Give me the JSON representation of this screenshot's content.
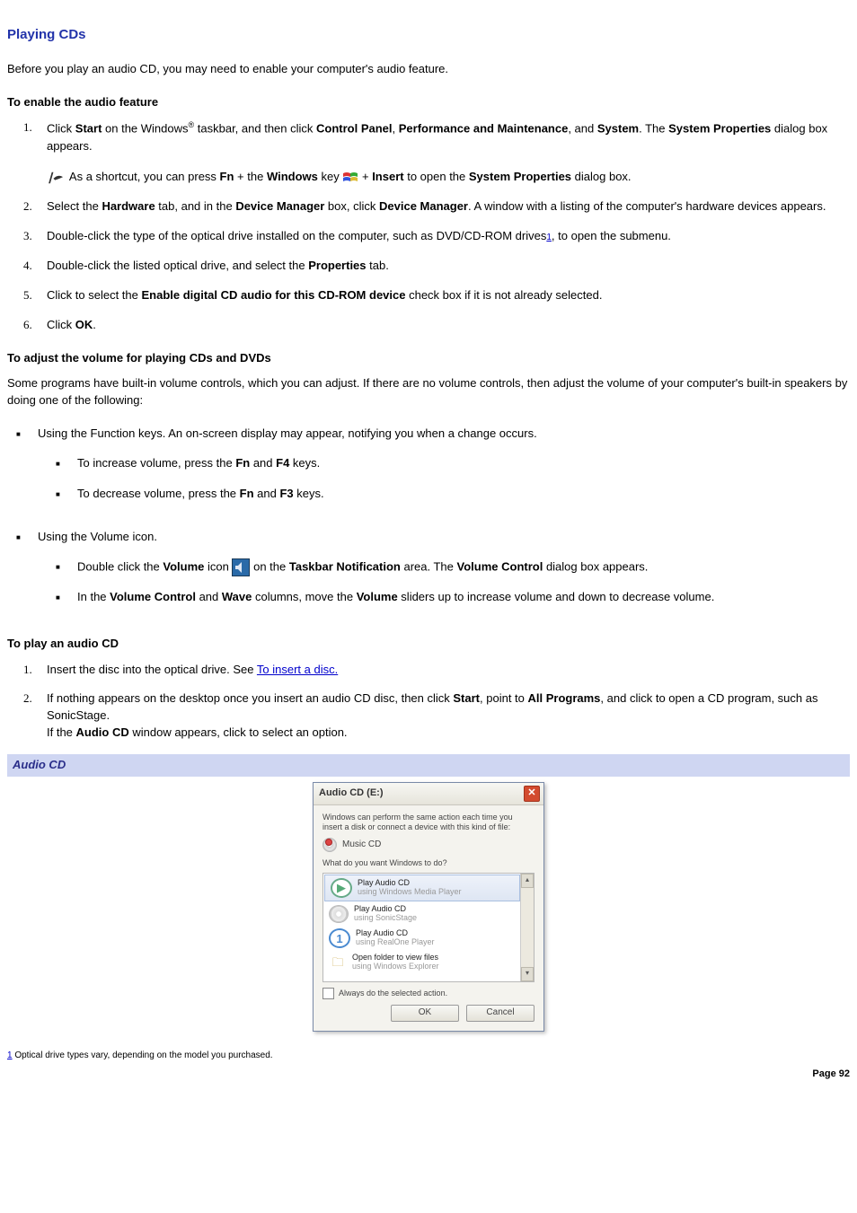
{
  "heading": "Playing CDs",
  "intro": "Before you play an audio CD, you may need to enable your computer's audio feature.",
  "section1_title": "To enable the audio feature",
  "s1_li1_a": "Click ",
  "s1_li1_b": "Start",
  "s1_li1_c": " on the Windows",
  "s1_li1_reg": "®",
  "s1_li1_d": " taskbar, and then click ",
  "s1_li1_e": "Control Panel",
  "s1_li1_f": ", ",
  "s1_li1_g": "Performance and Maintenance",
  "s1_li1_h": ", and ",
  "s1_li1_i": "System",
  "s1_li1_j": ". The ",
  "s1_li1_k": "System Properties",
  "s1_li1_l": " dialog box appears.",
  "s1_note_a": " As a shortcut, you can press ",
  "s1_note_b": "Fn",
  "s1_note_c": " + the ",
  "s1_note_d": "Windows",
  "s1_note_e": " key ",
  "s1_note_f": " + ",
  "s1_note_g": "Insert",
  "s1_note_h": " to open the ",
  "s1_note_i": "System Properties",
  "s1_note_j": " dialog box.",
  "s1_li2_a": "Select the ",
  "s1_li2_b": "Hardware",
  "s1_li2_c": " tab, and in the ",
  "s1_li2_d": "Device Manager",
  "s1_li2_e": " box, click ",
  "s1_li2_f": "Device Manager",
  "s1_li2_g": ". A window with a listing of the computer's hardware devices appears.",
  "s1_li3_a": "Double-click the type of the optical drive installed on the computer, such as DVD/CD-ROM drives",
  "s1_li3_ref": "1",
  "s1_li3_b": ", to open the submenu.",
  "s1_li4_a": "Double-click the listed optical drive, and select the ",
  "s1_li4_b": "Properties",
  "s1_li4_c": " tab.",
  "s1_li5_a": "Click to select the ",
  "s1_li5_b": "Enable digital CD audio for this CD-ROM device",
  "s1_li5_c": " check box if it is not already selected.",
  "s1_li6_a": "Click ",
  "s1_li6_b": "OK",
  "s1_li6_c": ".",
  "section2_title": "To adjust the volume for playing CDs and DVDs",
  "s2_intro": "Some programs have built-in volume controls, which you can adjust. If there are no volume controls, then adjust the volume of your computer's built-in speakers by doing one of the following:",
  "s2_b1": "Using the Function keys. An on-screen display may appear, notifying you when a change occurs.",
  "s2_b1_s1_a": "To increase volume, press the ",
  "s2_b1_s1_b": "Fn",
  "s2_b1_s1_c": " and ",
  "s2_b1_s1_d": "F4",
  "s2_b1_s1_e": " keys.",
  "s2_b1_s2_a": "To decrease volume, press the ",
  "s2_b1_s2_b": "Fn",
  "s2_b1_s2_c": " and ",
  "s2_b1_s2_d": "F3",
  "s2_b1_s2_e": " keys.",
  "s2_b2": "Using the Volume icon.",
  "s2_b2_s1_a": "Double click the ",
  "s2_b2_s1_b": "Volume",
  "s2_b2_s1_c": " icon ",
  "s2_b2_s1_d": " on the ",
  "s2_b2_s1_e": "Taskbar Notification",
  "s2_b2_s1_f": " area. The ",
  "s2_b2_s1_g": "Volume Control",
  "s2_b2_s1_h": " dialog box appears.",
  "s2_b2_s2_a": "In the ",
  "s2_b2_s2_b": "Volume Control",
  "s2_b2_s2_c": " and ",
  "s2_b2_s2_d": "Wave",
  "s2_b2_s2_e": " columns, move the ",
  "s2_b2_s2_f": "Volume",
  "s2_b2_s2_g": " sliders up to increase volume and down to decrease volume.",
  "section3_title": "To play an audio CD",
  "s3_li1_a": "Insert the disc into the optical drive. See ",
  "s3_li1_link": "To insert a disc.",
  "s3_li2_a": "If nothing appears on the desktop once you insert an audio CD disc, then click ",
  "s3_li2_b": "Start",
  "s3_li2_c": ", point to ",
  "s3_li2_d": "All Programs",
  "s3_li2_e": ", and click to open a CD program, such as SonicStage.",
  "s3_li2_f": "If the ",
  "s3_li2_g": "Audio CD",
  "s3_li2_h": " window appears, click to select an option.",
  "caption": "Audio CD",
  "dialog": {
    "title": "Audio CD (E:)",
    "instr": "Windows can perform the same action each time you insert a disk or connect a device with this kind of file:",
    "music": "Music CD",
    "prompt": "What do you want Windows to do?",
    "opts": [
      {
        "l1": "Play Audio CD",
        "l2": "using Windows Media Player"
      },
      {
        "l1": "Play Audio CD",
        "l2": "using SonicStage"
      },
      {
        "l1": "Play Audio CD",
        "l2": "using RealOne Player"
      },
      {
        "l1": "Open folder to view files",
        "l2": "using Windows Explorer"
      },
      {
        "l1": "",
        "l2": ""
      }
    ],
    "always": "Always do the selected action.",
    "ok": "OK",
    "cancel": "Cancel"
  },
  "footnote_id": "1",
  "footnote_text": " Optical drive types vary, depending on the model you purchased.",
  "page_number": "Page 92",
  "markers": {
    "n1": "1.",
    "n2": "2.",
    "n3": "3.",
    "n4": "4.",
    "n5": "5.",
    "n6": "6.",
    "sq": "■"
  }
}
